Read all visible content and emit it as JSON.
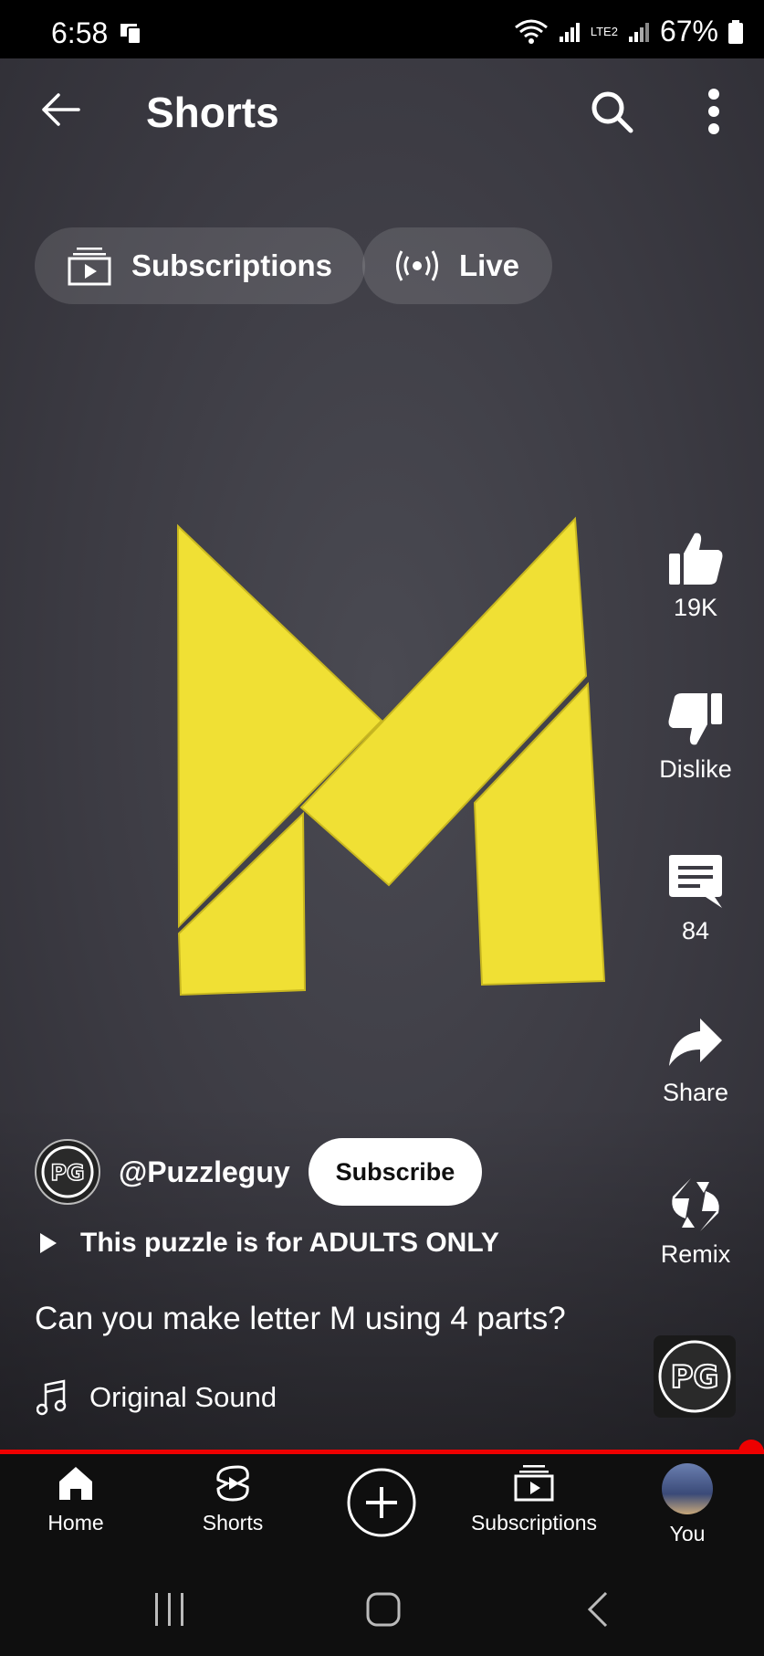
{
  "status_bar": {
    "time": "6:58",
    "network": "LTE2",
    "battery": "67%"
  },
  "header": {
    "title": "Shorts",
    "icons": [
      "back-arrow-icon",
      "search-icon",
      "more-vert-icon"
    ]
  },
  "chips": [
    {
      "label": "Subscriptions",
      "icon": "subscriptions-icon"
    },
    {
      "label": "Live",
      "icon": "live-icon"
    }
  ],
  "actions": {
    "like": "19K",
    "dislike": "Dislike",
    "comments": "84",
    "share": "Share",
    "remix": "Remix"
  },
  "channel": {
    "handle": "@Puzzleguy",
    "subscribe_label": "Subscribe",
    "avatar_text": "PG"
  },
  "playlist_label": "This puzzle is for ADULTS ONLY",
  "caption": "Can you make letter M using 4 parts?",
  "sound_label": "Original Sound",
  "video": {
    "accent": "#f0e034",
    "background": "#3f3e46",
    "progress_color": "#e00000",
    "progress": 1.0
  },
  "bottom_nav": [
    {
      "label": "Home",
      "icon": "home-icon"
    },
    {
      "label": "Shorts",
      "icon": "shorts-icon"
    },
    {
      "label": "",
      "icon": "create-plus-icon"
    },
    {
      "label": "Subscriptions",
      "icon": "subscriptions-icon"
    },
    {
      "label": "You",
      "icon": "profile-avatar"
    }
  ]
}
